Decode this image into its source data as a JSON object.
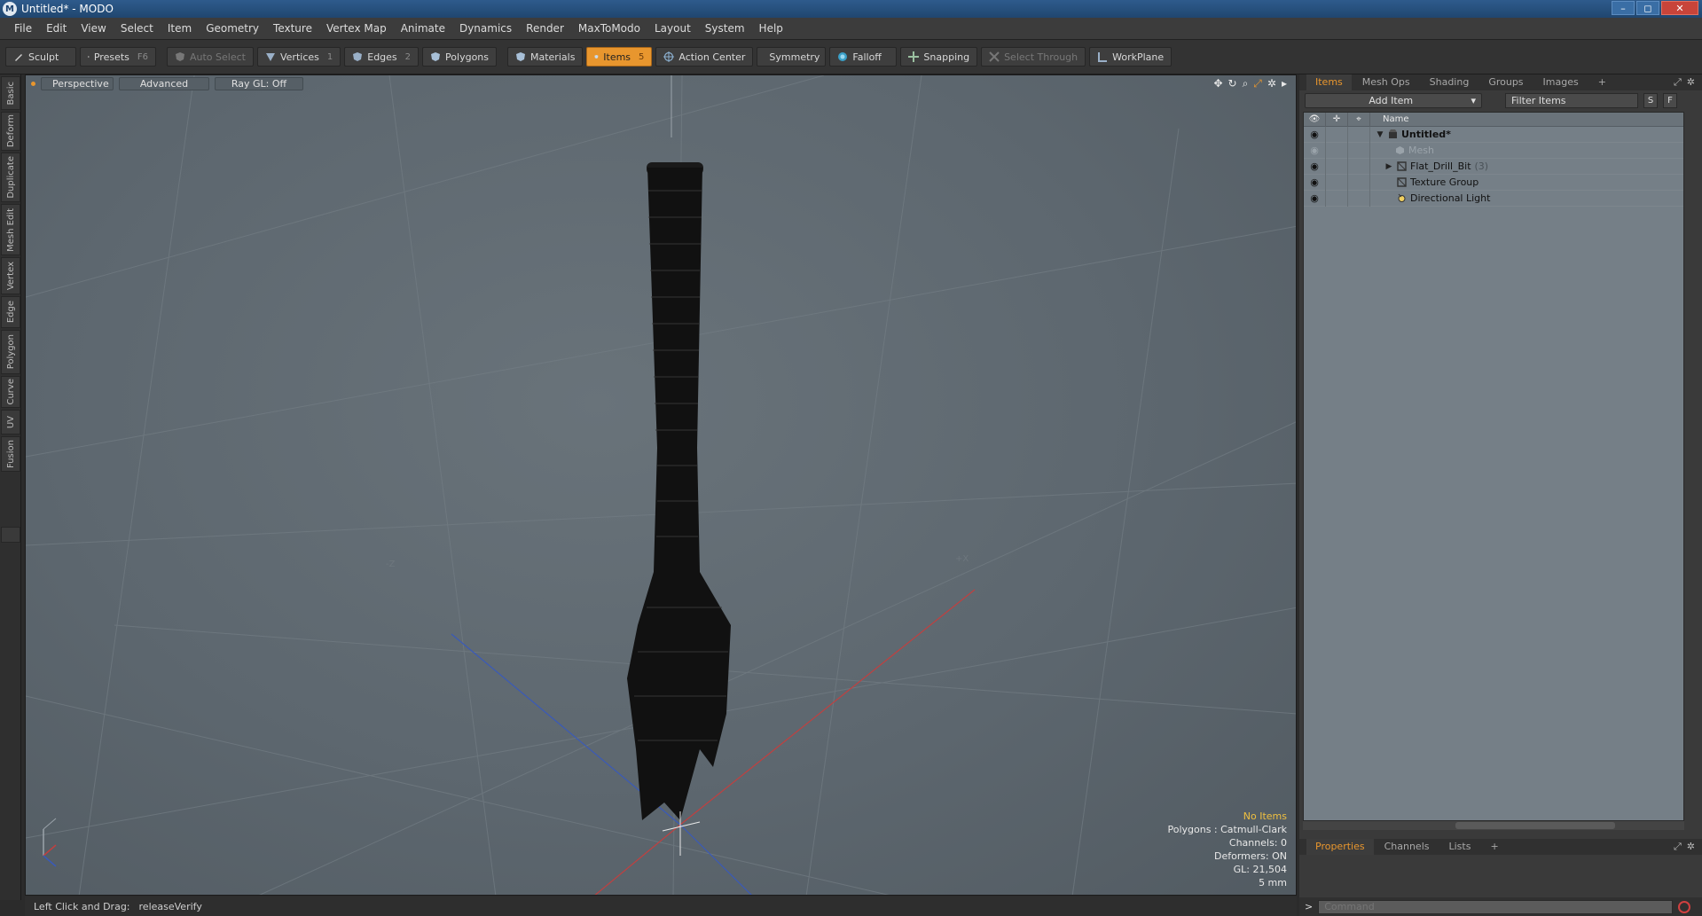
{
  "window": {
    "title": "Untitled* - MODO",
    "controls": [
      "–",
      "◻",
      "✕"
    ]
  },
  "menu": [
    "File",
    "Edit",
    "View",
    "Select",
    "Item",
    "Geometry",
    "Texture",
    "Vertex Map",
    "Animate",
    "Dynamics",
    "Render",
    "MaxToModo",
    "Layout",
    "System",
    "Help"
  ],
  "toolbar": {
    "sculpt": "Sculpt",
    "presets": "Presets",
    "presets_key": "F6",
    "auto_select": "Auto Select",
    "vertices": "Vertices",
    "vertices_key": "1",
    "edges": "Edges",
    "edges_key": "2",
    "polygons": "Polygons",
    "materials": "Materials",
    "items": "Items",
    "items_key": "5",
    "action_center": "Action Center",
    "symmetry": "Symmetry",
    "falloff": "Falloff",
    "snapping": "Snapping",
    "select_through": "Select Through",
    "workplane": "WorkPlane"
  },
  "left_tabs": [
    "Basic",
    "Deform",
    "Duplicate",
    "Mesh Edit",
    "Vertex",
    "Edge",
    "Polygon",
    "Curve",
    "UV",
    "Fusion"
  ],
  "viewport": {
    "view_tab": "Perspective",
    "mode_tab": "Advanced",
    "raygl_tab": "Ray GL: Off",
    "nav_icons": [
      "move-view-icon",
      "rotate-view-icon",
      "zoom-view-icon",
      "maximize-view-icon",
      "settings-icon",
      "expand-icon"
    ],
    "axis_labels": {
      "neg_x": "-Z",
      "pos_x": "+X"
    },
    "stats": {
      "selection": "No Items",
      "polygons": "Polygons : Catmull-Clark",
      "channels": "Channels: 0",
      "deformers": "Deformers: ON",
      "gl": "GL: 21,504",
      "scale": "5 mm"
    },
    "colors": {
      "highlight": "#f0c040"
    }
  },
  "status": {
    "hint_label": "Left Click and Drag:",
    "hint_value": "releaseVerify"
  },
  "items_panel": {
    "tabs": [
      "Items",
      "Mesh Ops",
      "Shading",
      "Groups",
      "Images"
    ],
    "active_tab": "Items",
    "add_item": "Add Item",
    "filter_placeholder": "Filter Items",
    "btn_s": "S",
    "btn_f": "F",
    "col_name": "Name",
    "tree": [
      {
        "label": "Untitled*",
        "bold": true,
        "arrow": "▼",
        "icon": "scene-icon"
      },
      {
        "label": "Mesh",
        "dim": true,
        "icon": "mesh-icon"
      },
      {
        "label": "Flat_Drill_Bit",
        "count": "(3)",
        "arrow": "▶",
        "icon": "locator-icon"
      },
      {
        "label": "Texture Group",
        "icon": "group-icon"
      },
      {
        "label": "Directional Light",
        "icon": "light-icon"
      }
    ]
  },
  "properties_panel": {
    "tabs": [
      "Properties",
      "Channels",
      "Lists"
    ],
    "active_tab": "Properties"
  },
  "command": {
    "prompt": ">",
    "placeholder": "Command"
  },
  "colors": {
    "accent": "#e8962e",
    "viewport_bg": "#5d676f",
    "list_bg": "#757f87"
  }
}
